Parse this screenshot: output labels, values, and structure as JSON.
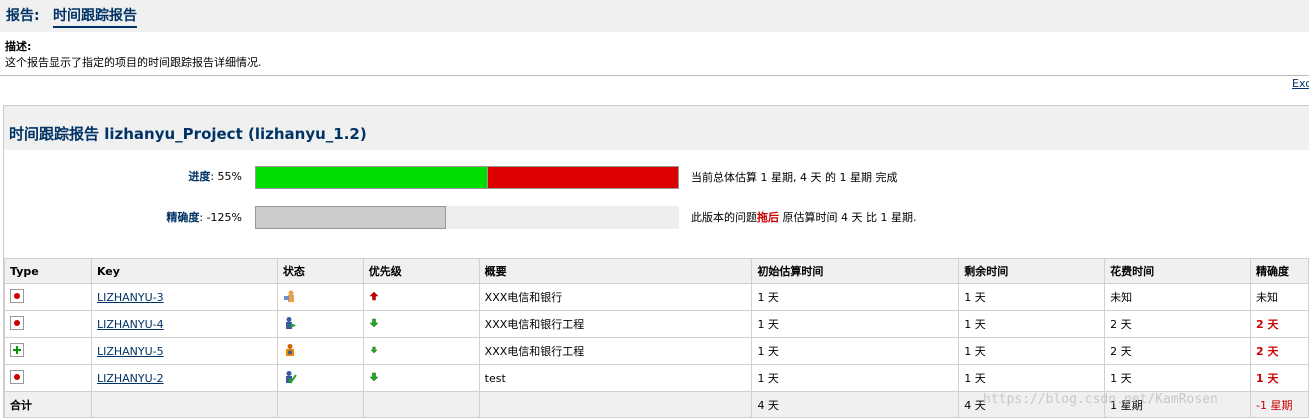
{
  "page": {
    "title_prefix": "报告:",
    "title": "时间跟踪报告",
    "desc_label": "描述:",
    "desc_text": "这个报告显示了指定的项目的时间跟踪报告详细情况.",
    "excel_link": "Exc"
  },
  "report": {
    "heading": "时间跟踪报告 lizhanyu_Project  (lizhanyu_1.2)",
    "progress": {
      "label": "进度",
      "value": ": 55%",
      "fraction": 0.55,
      "info": "当前总体估算 1 星期, 4 天 的 1 星期 完成"
    },
    "accuracy": {
      "label": "精确度",
      "value": ": -125%",
      "fraction": 0.45,
      "info_pre": "此版本的问题",
      "info_red": "拖后",
      "info_post": " 原估算时间 4 天 比 1 星期."
    },
    "colors": {
      "green": "#00dd00",
      "red": "#dd0000",
      "gray": "#cccccc",
      "track": "#eeeeee"
    }
  },
  "table": {
    "headers": [
      "Type",
      "Key",
      "状态",
      "优先级",
      "概要",
      "初始估算时间",
      "剩余时间",
      "花费时间",
      "精确度"
    ],
    "rows": [
      {
        "type_icon": "bug-icon",
        "key": "LIZHANYU-3",
        "status_icon": "status-open-icon",
        "priority_icon": "priority-up-icon",
        "summary": "XXX电信和银行",
        "orig": "1 天",
        "remain": "1 天",
        "spent": "未知",
        "acc": "未知",
        "acc_red": false
      },
      {
        "type_icon": "bug-icon",
        "key": "LIZHANYU-4",
        "status_icon": "status-in-progress-icon",
        "priority_icon": "priority-down-icon",
        "summary": "XXX电信和银行工程",
        "orig": "1 天",
        "remain": "1 天",
        "spent": "2 天",
        "acc": "2 天",
        "acc_red": true
      },
      {
        "type_icon": "new-feature-icon",
        "key": "LIZHANYU-5",
        "status_icon": "status-reopened-icon",
        "priority_icon": "priority-down-small-icon",
        "summary": "XXX电信和银行工程",
        "orig": "1 天",
        "remain": "1 天",
        "spent": "2 天",
        "acc": "2 天",
        "acc_red": true
      },
      {
        "type_icon": "bug-icon",
        "key": "LIZHANYU-2",
        "status_icon": "status-resolved-icon",
        "priority_icon": "priority-down-icon",
        "summary": "test",
        "orig": "1 天",
        "remain": "1 天",
        "spent": "1 天",
        "acc": "1 天",
        "acc_red": true
      }
    ],
    "total": {
      "label": "合计",
      "orig": "4 天",
      "remain": "4 天",
      "spent": "1 星期",
      "acc": "-1 星期"
    }
  },
  "watermark": "https://blog.csdn.net/KamRosen"
}
